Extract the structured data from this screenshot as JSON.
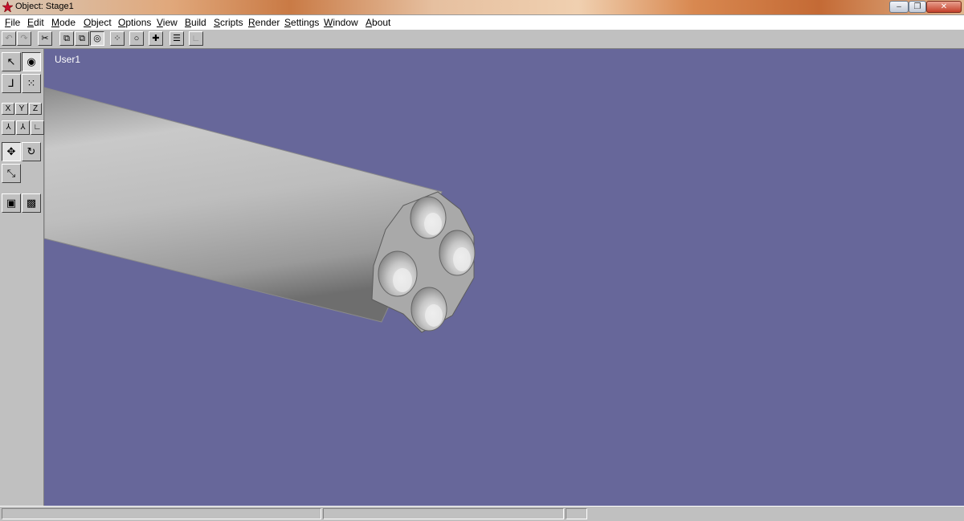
{
  "window": {
    "title": "Object: Stage1",
    "controls": {
      "minimize": "–",
      "maximize": "❐",
      "close": "✕"
    }
  },
  "menu": {
    "items": [
      "File",
      "Edit",
      "Mode",
      "Object",
      "Options",
      "View",
      "Build",
      "Scripts",
      "Render",
      "Settings",
      "Window",
      "About"
    ]
  },
  "toolbar": {
    "buttons": [
      {
        "icon": "undo-icon",
        "glyph": "↶",
        "enabled": false
      },
      {
        "icon": "redo-icon",
        "glyph": "↷",
        "enabled": false
      },
      {
        "icon": "cut-icon",
        "glyph": "✂",
        "enabled": true
      },
      {
        "icon": "copy-object-icon",
        "glyph": "⧉",
        "enabled": true
      },
      {
        "icon": "paste-object-icon",
        "glyph": "⧉",
        "enabled": true
      },
      {
        "icon": "sphere-icon",
        "glyph": "◎",
        "enabled": true,
        "pressed": true
      },
      {
        "icon": "cluster-icon",
        "glyph": "⁘",
        "enabled": true
      },
      {
        "icon": "ring-icon",
        "glyph": "○",
        "enabled": true
      },
      {
        "icon": "add-point-icon",
        "glyph": "✚",
        "enabled": true
      },
      {
        "icon": "list-icon",
        "glyph": "☰",
        "enabled": true
      },
      {
        "icon": "graph-icon",
        "glyph": "∟",
        "enabled": false
      }
    ]
  },
  "palette": {
    "tools": [
      {
        "icon": "select-arrow-icon",
        "glyph": "↖",
        "pressed": false
      },
      {
        "icon": "eye-icon",
        "glyph": "◉",
        "pressed": true
      },
      {
        "icon": "axes-icon",
        "glyph": "⅃",
        "pressed": false
      },
      {
        "icon": "dots-icon",
        "glyph": "⁙",
        "pressed": false
      },
      {
        "icon": "move-icon",
        "glyph": "✥",
        "pressed": true
      },
      {
        "icon": "rotate-icon",
        "glyph": "↻",
        "pressed": false
      },
      {
        "icon": "scale-icon",
        "glyph": "⤡",
        "pressed": false
      },
      {
        "icon": "frame-icon",
        "glyph": "▣",
        "pressed": false
      },
      {
        "icon": "texture-icon",
        "glyph": "▩",
        "pressed": false
      }
    ],
    "axis_buttons": [
      "X",
      "Y",
      "Z"
    ],
    "small_tools": [
      {
        "icon": "mirror-left-icon",
        "glyph": "⅄"
      },
      {
        "icon": "mirror-right-icon",
        "glyph": "⅄"
      },
      {
        "icon": "corner-icon",
        "glyph": "∟"
      }
    ]
  },
  "viewport": {
    "label": "User1",
    "background": "#67679a"
  },
  "colors": {
    "ui_gray": "#c0c0c0",
    "viewport": "#67679a",
    "model": "#b9b9b9"
  }
}
